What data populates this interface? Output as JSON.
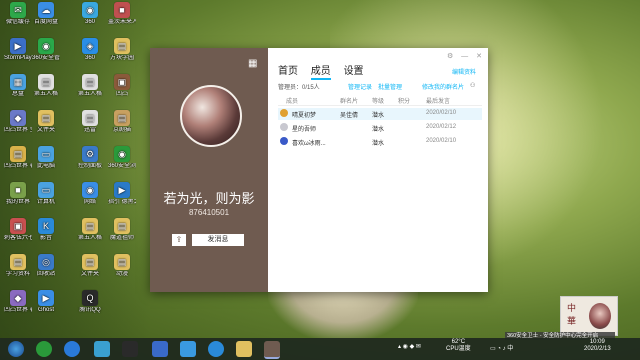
{
  "desktop_icons": [
    {
      "label": "微信缓存",
      "color": "#2ea84a",
      "glyph": "✉"
    },
    {
      "label": "StormPlayer 快捷方式",
      "color": "#3b6fc7",
      "glyph": "▶"
    },
    {
      "label": "总盘",
      "color": "#4aa2e0",
      "glyph": "▦"
    },
    {
      "label": "凹凸世界 全员表情",
      "color": "#6a79c8",
      "glyph": "◆"
    },
    {
      "label": "凹凸世界 表情包",
      "color": "#d9b24a",
      "glyph": "▤"
    },
    {
      "label": "我的世界",
      "color": "#7aa04a",
      "glyph": "■"
    },
    {
      "label": "刺客伍六七",
      "color": "#c95050",
      "glyph": "▣"
    },
    {
      "label": "学习资料",
      "color": "#e0c060",
      "glyph": "▤"
    },
    {
      "label": "凹凸世界 表情包",
      "color": "#8a6ac0",
      "glyph": "◆"
    },
    {
      "label": "百度网盘",
      "color": "#3a8ee6",
      "glyph": "☁"
    },
    {
      "label": "360安全管家",
      "color": "#2aa84a",
      "glyph": "◉"
    },
    {
      "label": "第五人格",
      "color": "#e0e0e0",
      "glyph": "▤"
    },
    {
      "label": "文件夹",
      "color": "#e0c060",
      "glyph": "▤"
    },
    {
      "label": "此电脑",
      "color": "#4aa2e0",
      "glyph": "▭"
    },
    {
      "label": "计算机",
      "color": "#4aa2e0",
      "glyph": "▭"
    },
    {
      "label": "影音",
      "color": "#2a8ad8",
      "glyph": "K"
    },
    {
      "label": "回收站",
      "color": "#3a7ac8",
      "glyph": "◎"
    },
    {
      "label": "Ghost",
      "color": "#3a8ee6",
      "glyph": "▶"
    },
    {
      "label": "360",
      "color": "#3aa8e0",
      "glyph": "◉"
    },
    {
      "label": "360",
      "color": "#2a8ee6",
      "glyph": "◈"
    },
    {
      "label": "第五人格",
      "color": "#e0e0e0",
      "glyph": "▤"
    },
    {
      "label": "迅雷",
      "color": "#e0e0e0",
      "glyph": "▤"
    },
    {
      "label": "控制面板",
      "color": "#3a7ac8",
      "glyph": "⚙"
    },
    {
      "label": "网络",
      "color": "#3a8ee6",
      "glyph": "◉"
    },
    {
      "label": "第五人格",
      "color": "#e0c060",
      "glyph": "▤"
    },
    {
      "label": "文件夹",
      "color": "#e0c060",
      "glyph": "▤"
    },
    {
      "label": "腾讯QQ",
      "color": "#2a2a2a",
      "glyph": "Q"
    },
    {
      "label": "盖茨未来人大",
      "color": "#c05050",
      "glyph": "■"
    },
    {
      "label": "方块学园",
      "color": "#e0c060",
      "glyph": "▤"
    },
    {
      "label": "凹凸",
      "color": "#8a5a3a",
      "glyph": "▣"
    },
    {
      "label": "京剧猫",
      "color": "#c8a060",
      "glyph": "▤"
    },
    {
      "label": "360安全浏览器",
      "color": "#2a9a3a",
      "glyph": "◉"
    },
    {
      "label": "指引 德黑之王",
      "color": "#2a7ac8",
      "glyph": "▶"
    },
    {
      "label": "魔道祖师",
      "color": "#e0c060",
      "glyph": "▤"
    },
    {
      "label": "动漫",
      "color": "#e0c060",
      "glyph": "▤"
    }
  ],
  "window": {
    "group_name": "若为光，则为影",
    "group_number": "876410501",
    "send_message": "发消息",
    "tabs": [
      "首页",
      "成员",
      "设置"
    ],
    "active_tab": 1,
    "edit_profile": "编辑资料",
    "managers": "管理员：0/15人",
    "actions": [
      "管理记录",
      "批量管理",
      "修改我的群名片"
    ],
    "columns": [
      "成员",
      "群名片",
      "等级",
      "积分",
      "最后发言"
    ],
    "members": [
      {
        "name": "晴夏初梦",
        "card": "吴佳倩",
        "level": "潜水",
        "score": "",
        "last": "2020/02/10",
        "color": "#e0a030"
      },
      {
        "name": "星的吾师",
        "card": "",
        "level": "潜水",
        "score": "",
        "last": "2020/02/12",
        "color": "#c8c8d0"
      },
      {
        "name": "喜欢ω冰雨...",
        "card": "",
        "level": "潜水",
        "score": "",
        "last": "2020/02/10",
        "color": "#3a5ac8"
      }
    ]
  },
  "notice": "360安全卫士 - 安全防护中心完全开启",
  "taskbar": {
    "temp": "62°C",
    "temp_label": "CPU温度",
    "time": "10:09",
    "date": "2020/2/13"
  }
}
